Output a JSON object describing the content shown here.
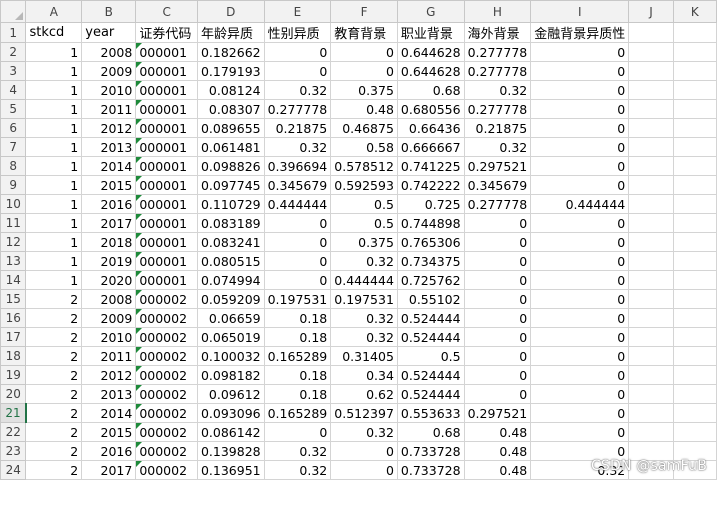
{
  "columns": [
    "A",
    "B",
    "C",
    "D",
    "E",
    "F",
    "G",
    "H",
    "I",
    "J",
    "K"
  ],
  "headers": [
    "stkcd",
    "year",
    "证券代码",
    "年龄异质",
    "性别异质",
    "教育背景",
    "职业背景",
    "海外背景",
    "金融背景异质性",
    "",
    ""
  ],
  "rows": [
    [
      "1",
      "2008",
      "000001",
      "0.182662",
      "0",
      "0",
      "0.644628",
      "0.277778",
      "0"
    ],
    [
      "1",
      "2009",
      "000001",
      "0.179193",
      "0",
      "0",
      "0.644628",
      "0.277778",
      "0"
    ],
    [
      "1",
      "2010",
      "000001",
      "0.08124",
      "0.32",
      "0.375",
      "0.68",
      "0.32",
      "0"
    ],
    [
      "1",
      "2011",
      "000001",
      "0.08307",
      "0.277778",
      "0.48",
      "0.680556",
      "0.277778",
      "0"
    ],
    [
      "1",
      "2012",
      "000001",
      "0.089655",
      "0.21875",
      "0.46875",
      "0.66436",
      "0.21875",
      "0"
    ],
    [
      "1",
      "2013",
      "000001",
      "0.061481",
      "0.32",
      "0.58",
      "0.666667",
      "0.32",
      "0"
    ],
    [
      "1",
      "2014",
      "000001",
      "0.098826",
      "0.396694",
      "0.578512",
      "0.741225",
      "0.297521",
      "0"
    ],
    [
      "1",
      "2015",
      "000001",
      "0.097745",
      "0.345679",
      "0.592593",
      "0.742222",
      "0.345679",
      "0"
    ],
    [
      "1",
      "2016",
      "000001",
      "0.110729",
      "0.444444",
      "0.5",
      "0.725",
      "0.277778",
      "0.444444"
    ],
    [
      "1",
      "2017",
      "000001",
      "0.083189",
      "0",
      "0.5",
      "0.744898",
      "0",
      "0"
    ],
    [
      "1",
      "2018",
      "000001",
      "0.083241",
      "0",
      "0.375",
      "0.765306",
      "0",
      "0"
    ],
    [
      "1",
      "2019",
      "000001",
      "0.080515",
      "0",
      "0.32",
      "0.734375",
      "0",
      "0"
    ],
    [
      "1",
      "2020",
      "000001",
      "0.074994",
      "0",
      "0.444444",
      "0.725762",
      "0",
      "0"
    ],
    [
      "2",
      "2008",
      "000002",
      "0.059209",
      "0.197531",
      "0.197531",
      "0.55102",
      "0",
      "0"
    ],
    [
      "2",
      "2009",
      "000002",
      "0.06659",
      "0.18",
      "0.32",
      "0.524444",
      "0",
      "0"
    ],
    [
      "2",
      "2010",
      "000002",
      "0.065019",
      "0.18",
      "0.32",
      "0.524444",
      "0",
      "0"
    ],
    [
      "2",
      "2011",
      "000002",
      "0.100032",
      "0.165289",
      "0.31405",
      "0.5",
      "0",
      "0"
    ],
    [
      "2",
      "2012",
      "000002",
      "0.098182",
      "0.18",
      "0.34",
      "0.524444",
      "0",
      "0"
    ],
    [
      "2",
      "2013",
      "000002",
      "0.09612",
      "0.18",
      "0.62",
      "0.524444",
      "0",
      "0"
    ],
    [
      "2",
      "2014",
      "000002",
      "0.093096",
      "0.165289",
      "0.512397",
      "0.553633",
      "0.297521",
      "0"
    ],
    [
      "2",
      "2015",
      "000002",
      "0.086142",
      "0",
      "0.32",
      "0.68",
      "0.48",
      "0"
    ],
    [
      "2",
      "2016",
      "000002",
      "0.139828",
      "0.32",
      "0",
      "0.733728",
      "0.48",
      "0"
    ],
    [
      "2",
      "2017",
      "000002",
      "0.136951",
      "0.32",
      "0",
      "0.733728",
      "0.48",
      "0.32"
    ]
  ],
  "selected_row": "21",
  "watermark": "CSDN @samFuB"
}
